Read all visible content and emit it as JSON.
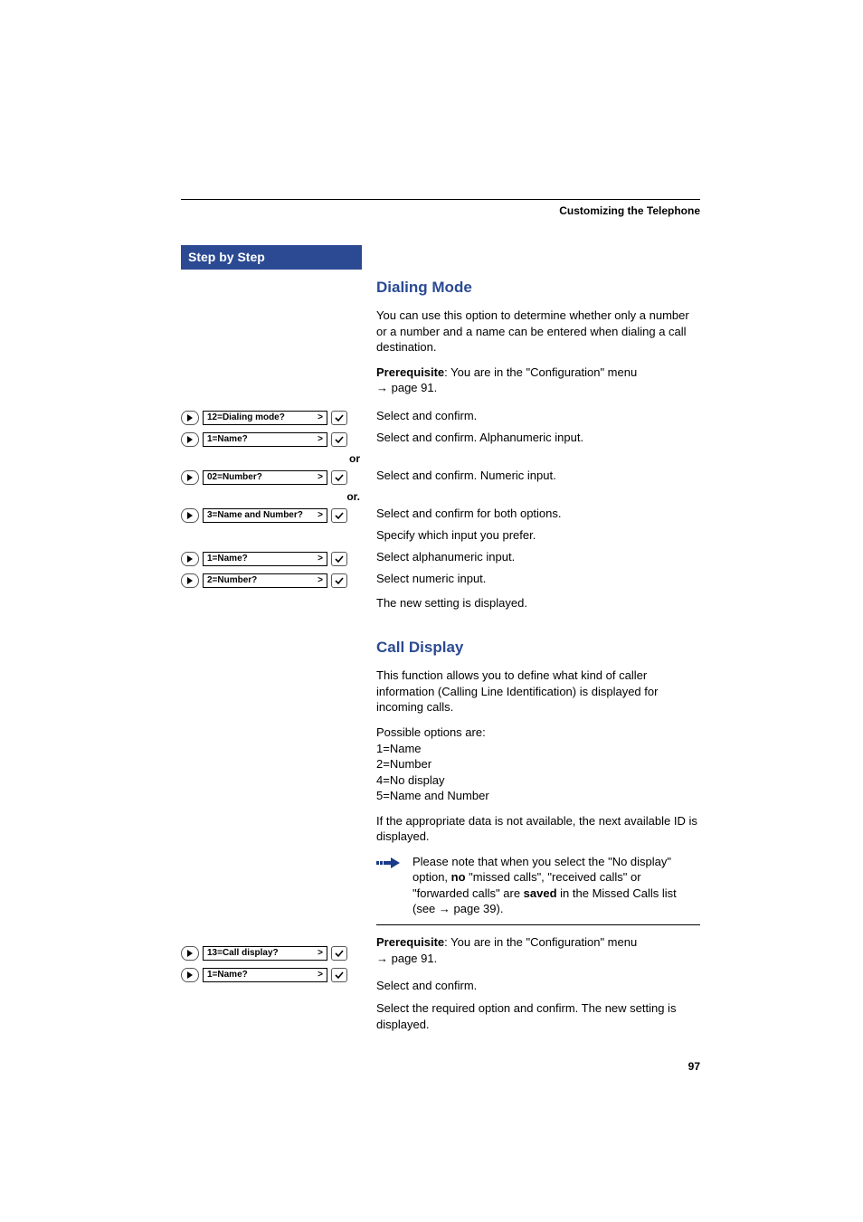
{
  "running_header": "Customizing the Telephone",
  "sidebar_title": "Step by Step",
  "page_number": "97",
  "labels": {
    "or": "or",
    "or_dot": "or."
  },
  "sections": {
    "dialing": {
      "heading": "Dialing Mode",
      "intro": "You can use this option to determine whether only a number or a number and a name can be entered when dialing a call destination.",
      "prereq_label": "Prerequisite",
      "prereq_text": ": You are in the \"Configuration\" menu",
      "prereq_ref": " page 91.",
      "steps": [
        {
          "display": "12=Dialing mode?",
          "desc": "Select and confirm."
        },
        {
          "display": "1=Name?",
          "desc": "Select and confirm. Alphanumeric input."
        },
        {
          "display": "02=Number?",
          "desc": "Select and confirm. Numeric input."
        },
        {
          "display": "3=Name and Number?",
          "desc": "Select and confirm for both options."
        }
      ],
      "specify": "Specify which input you prefer.",
      "steps2": [
        {
          "display": "1=Name?",
          "desc": "Select alphanumeric input."
        },
        {
          "display": "2=Number?",
          "desc": "Select numeric input."
        }
      ],
      "result": "The new setting is displayed."
    },
    "calldisplay": {
      "heading": "Call Display",
      "intro": "This function allows you to define what kind of caller information (Calling Line Identification) is displayed for incoming calls.",
      "options_label": "Possible options are:",
      "options": [
        "1=Name",
        "2=Number",
        "4=No display",
        "5=Name and Number"
      ],
      "fallback": "If the appropriate data is not available, the next available ID is displayed.",
      "note_pre": "Please note that when you select the \"No display\" option, ",
      "note_bold1": "no",
      "note_mid": " \"missed calls\", \"received calls\" or \"forwarded calls\" are ",
      "note_bold2": "saved",
      "note_post": " in the Missed Calls list (see ",
      "note_ref": " page 39).",
      "prereq_label": "Prerequisite",
      "prereq_text": ": You are in the \"Configuration\" menu",
      "prereq_ref": " page 91.",
      "steps": [
        {
          "display": "13=Call display?",
          "desc": "Select and confirm."
        },
        {
          "display": "1=Name?",
          "desc": "Select the required option and confirm. The new setting is displayed."
        }
      ]
    }
  }
}
